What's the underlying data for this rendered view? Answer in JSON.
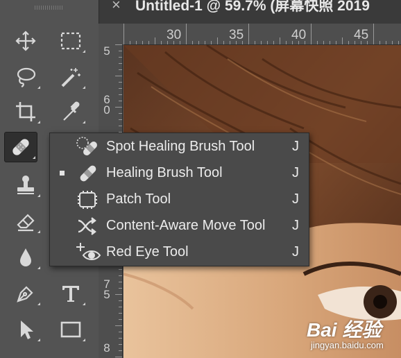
{
  "document_tab": {
    "close_symbol": "×",
    "title": "Untitled-1 @ 59.7% (屏幕快照 2019"
  },
  "ruler": {
    "horizontal_labels": [
      "30",
      "35",
      "40",
      "45"
    ],
    "vertical_labels": [
      "5",
      "6\n0",
      "7\n5",
      "8"
    ]
  },
  "toolbar": {
    "tools": [
      {
        "name": "move-tool",
        "icon": "move-icon"
      },
      {
        "name": "marquee-tool",
        "icon": "rect-marquee-icon"
      },
      {
        "name": "lasso-tool",
        "icon": "lasso-icon"
      },
      {
        "name": "magic-wand-tool",
        "icon": "magic-wand-icon"
      },
      {
        "name": "crop-tool",
        "icon": "crop-icon"
      },
      {
        "name": "eyedropper-tool",
        "icon": "eyedropper-icon"
      },
      {
        "name": "healing-brush-tool",
        "icon": "bandage-icon",
        "selected": true
      },
      {
        "name": "stamp-tool",
        "icon": "stamp-icon"
      },
      {
        "name": "eraser-tool",
        "icon": "eraser-icon"
      },
      {
        "name": "blur-tool",
        "icon": "drop-icon"
      },
      {
        "name": "pen-tool",
        "icon": "pen-icon"
      },
      {
        "name": "type-tool",
        "icon": "type-icon"
      },
      {
        "name": "path-selection-tool",
        "icon": "arrow-icon"
      },
      {
        "name": "rectangle-tool",
        "icon": "rectangle-icon"
      }
    ]
  },
  "flyout_menu": {
    "items": [
      {
        "label": "Spot Healing Brush Tool",
        "shortcut": "J",
        "icon": "spot-healing-icon",
        "active": false
      },
      {
        "label": "Healing Brush Tool",
        "shortcut": "J",
        "icon": "bandage-icon",
        "active": true
      },
      {
        "label": "Patch Tool",
        "shortcut": "J",
        "icon": "patch-icon",
        "active": false
      },
      {
        "label": "Content-Aware Move Tool",
        "shortcut": "J",
        "icon": "content-aware-move-icon",
        "active": false
      },
      {
        "label": "Red Eye Tool",
        "shortcut": "J",
        "icon": "red-eye-icon",
        "active": false
      }
    ]
  },
  "watermark": {
    "brand": "Bai 经验",
    "site": "jingyan.baidu.com"
  },
  "colors": {
    "panel": "#535353",
    "menu_bg": "#4a4a4a",
    "text": "#ececec"
  }
}
